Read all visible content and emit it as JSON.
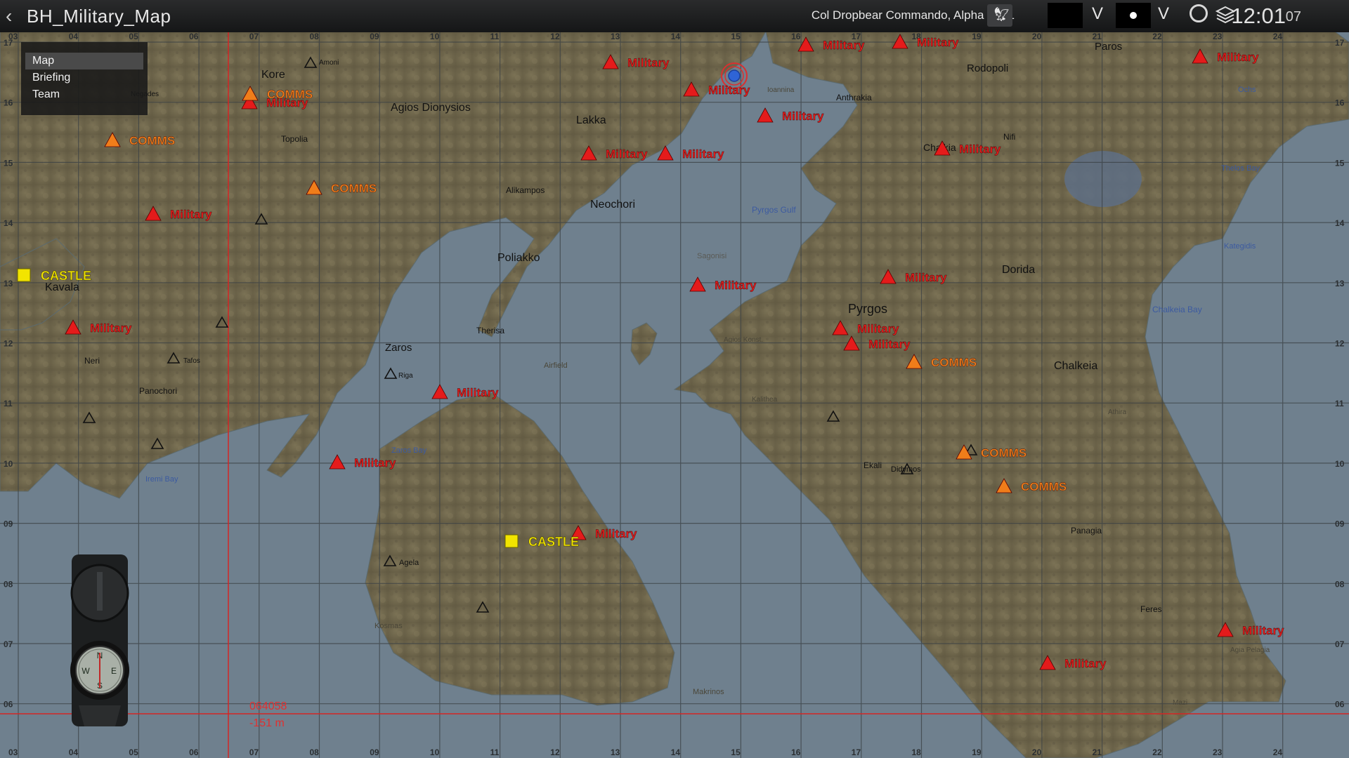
{
  "app": {
    "title": "BH_Military_Map",
    "player": "Col Dropbear Commando, Alpha 1-1 1",
    "clock": "12:01",
    "clock_seconds": "07"
  },
  "menu": {
    "items": [
      {
        "label": "Map",
        "active": true
      },
      {
        "label": "Briefing",
        "active": false
      },
      {
        "label": "Team",
        "active": false
      }
    ]
  },
  "cursor": {
    "grid": "064058",
    "elevation": "-151 m"
  },
  "grid": {
    "x_labels": [
      "03",
      "04",
      "05",
      "06",
      "07",
      "08",
      "09",
      "10",
      "11",
      "12",
      "13",
      "14",
      "15",
      "16",
      "17",
      "18",
      "19",
      "20",
      "21",
      "22",
      "23",
      "24"
    ],
    "y_labels": [
      "17",
      "16",
      "15",
      "14",
      "13",
      "12",
      "11",
      "10",
      "09",
      "08",
      "07",
      "06"
    ]
  },
  "markers": [
    {
      "type": "military",
      "label": "Military"
    },
    {
      "type": "military",
      "label": "Military"
    },
    {
      "type": "military",
      "label": "Military"
    },
    {
      "type": "military",
      "label": "Military"
    },
    {
      "type": "military",
      "label": "Military"
    },
    {
      "type": "military",
      "label": "Military"
    },
    {
      "type": "military",
      "label": "Military"
    },
    {
      "type": "military",
      "label": "Military"
    },
    {
      "type": "military",
      "label": "Military"
    },
    {
      "type": "military",
      "label": "Military"
    },
    {
      "type": "military",
      "label": "Military"
    },
    {
      "type": "military",
      "label": "Military"
    },
    {
      "type": "military",
      "label": "Military"
    },
    {
      "type": "military",
      "label": "Military"
    },
    {
      "type": "military",
      "label": "Military"
    },
    {
      "type": "military",
      "label": "Military"
    },
    {
      "type": "military",
      "label": "Military"
    },
    {
      "type": "military",
      "label": "Military"
    },
    {
      "type": "military",
      "label": "Military"
    },
    {
      "type": "military",
      "label": "Military"
    },
    {
      "type": "military",
      "label": "Military"
    },
    {
      "type": "comms",
      "label": "COMMS"
    },
    {
      "type": "comms",
      "label": "COMMS"
    },
    {
      "type": "comms",
      "label": "COMMS"
    },
    {
      "type": "comms",
      "label": "COMMS"
    },
    {
      "type": "comms",
      "label": "COMMS"
    },
    {
      "type": "comms",
      "label": "COMMS"
    },
    {
      "type": "castle",
      "label": "CASTLE"
    },
    {
      "type": "castle",
      "label": "CASTLE"
    }
  ],
  "towns": [
    "Kore",
    "Agios Dionysios",
    "Lakka",
    "Rodopoli",
    "Paros",
    "Anthrakia",
    "Topolia",
    "Nifi",
    "Chalkia",
    "Alikampos",
    "Neochori",
    "Kavala",
    "Poliakko",
    "Dorida",
    "Pyrgos",
    "Therisa",
    "Zaros",
    "Neri",
    "Chalkeia",
    "Panochori",
    "Ekali",
    "Didymos",
    "Panagia",
    "Agela",
    "Feres",
    "Kosmas",
    "Riga",
    "Tafos",
    "Negades",
    "Amoni",
    "Ochs",
    "Kategidis",
    "Pyrgos Gulf",
    "Sagonisi",
    "Chalkeia Bay",
    "Thelos Bay",
    "Zaros Bay",
    "Iremi Bay",
    "Airfield",
    "Makrinos",
    "Agia Pelagia",
    "Ioannina",
    "Athira",
    "Agios Konst.",
    "Mazi",
    "Kalithea"
  ],
  "colors": {
    "military": "#e41b1b",
    "comms": "#f07d1a",
    "castle": "#f2e400",
    "sea": "#6e7f8d",
    "land": "#746c52",
    "gridline": "#3b3f42",
    "crosshair": "#d42525"
  }
}
